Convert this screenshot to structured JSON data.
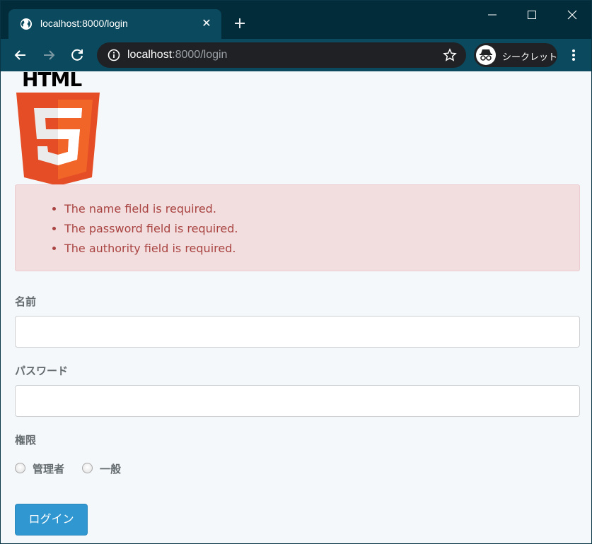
{
  "browser": {
    "tab_title": "localhost:8000/login",
    "url_host": "localhost",
    "url_path": ":8000/login",
    "incognito_label": "シークレット"
  },
  "logo": {
    "text": "HTML"
  },
  "errors": [
    "The name field is required.",
    "The password field is required.",
    "The authority field is required."
  ],
  "form": {
    "name_label": "名前",
    "password_label": "パスワード",
    "authority_label": "権限",
    "authority_options": [
      "管理者",
      "一般"
    ],
    "submit_label": "ログイン"
  },
  "colors": {
    "accent": "#3097d1",
    "error_bg": "#f2dede",
    "error_text": "#a94442",
    "html5_orange": "#e44d26",
    "html5_light": "#f16529"
  }
}
